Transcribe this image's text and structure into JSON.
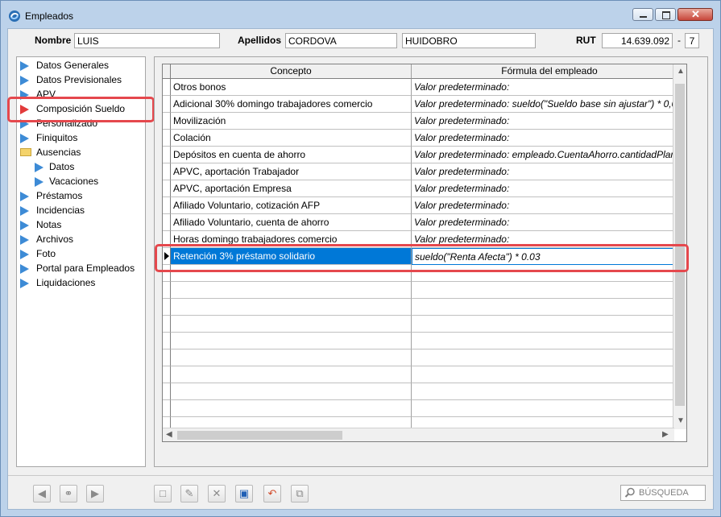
{
  "window": {
    "title": "Empleados"
  },
  "header": {
    "nombre_label": "Nombre",
    "nombre_value": "LUIS",
    "apellidos_label": "Apellidos",
    "apellido1": "CORDOVA",
    "apellido2": "HUIDOBRO",
    "rut_label": "RUT",
    "rut_value": "14.639.092",
    "rut_dash": "-",
    "rut_dv": "7"
  },
  "sidebar": {
    "items": [
      {
        "label": "Datos Generales"
      },
      {
        "label": "Datos Previsionales"
      },
      {
        "label": "APV"
      },
      {
        "label": "Composición Sueldo"
      },
      {
        "label": "Personalizado"
      },
      {
        "label": "Finiquitos"
      },
      {
        "label": "Ausencias"
      },
      {
        "label": "Datos"
      },
      {
        "label": "Vacaciones"
      },
      {
        "label": "Préstamos"
      },
      {
        "label": "Incidencias"
      },
      {
        "label": "Notas"
      },
      {
        "label": "Archivos"
      },
      {
        "label": "Foto"
      },
      {
        "label": "Portal para Empleados"
      },
      {
        "label": "Liquidaciones"
      }
    ],
    "selected": "Composición Sueldo"
  },
  "grid": {
    "columns": [
      "Concepto",
      "Fórmula del empleado"
    ],
    "rows": [
      {
        "concepto": "Otros bonos",
        "formula": "Valor predeterminado:"
      },
      {
        "concepto": "Adicional 30% domingo trabajadores comercio",
        "formula": "Valor predeterminado: sueldo(\"Sueldo base sin ajustar\") * 0,0"
      },
      {
        "concepto": "Movilización",
        "formula": "Valor predeterminado:"
      },
      {
        "concepto": "Colación",
        "formula": "Valor predeterminado:"
      },
      {
        "concepto": "Depósitos en cuenta de ahorro",
        "formula": "Valor predeterminado: empleado.CuentaAhorro.cantidadPlar"
      },
      {
        "concepto": "APVC, aportación Trabajador",
        "formula": "Valor predeterminado:"
      },
      {
        "concepto": "APVC, aportación Empresa",
        "formula": "Valor predeterminado:"
      },
      {
        "concepto": "Afiliado Voluntario, cotización AFP",
        "formula": "Valor predeterminado:"
      },
      {
        "concepto": "Afiliado Voluntario, cuenta de ahorro",
        "formula": "Valor predeterminado:"
      },
      {
        "concepto": "Horas domingo trabajadores comercio",
        "formula": "Valor predeterminado:"
      },
      {
        "concepto": "Retención 3% préstamo solidario",
        "formula": "sueldo(\"Renta Afecta\") * 0.03"
      }
    ],
    "selected_row": 10
  },
  "toolbar": {
    "search_placeholder": "BÚSQUEDA"
  },
  "colors": {
    "selection": "#0078d7",
    "highlight": "#e5484d",
    "tree_arrow": "#3d8bd6"
  }
}
